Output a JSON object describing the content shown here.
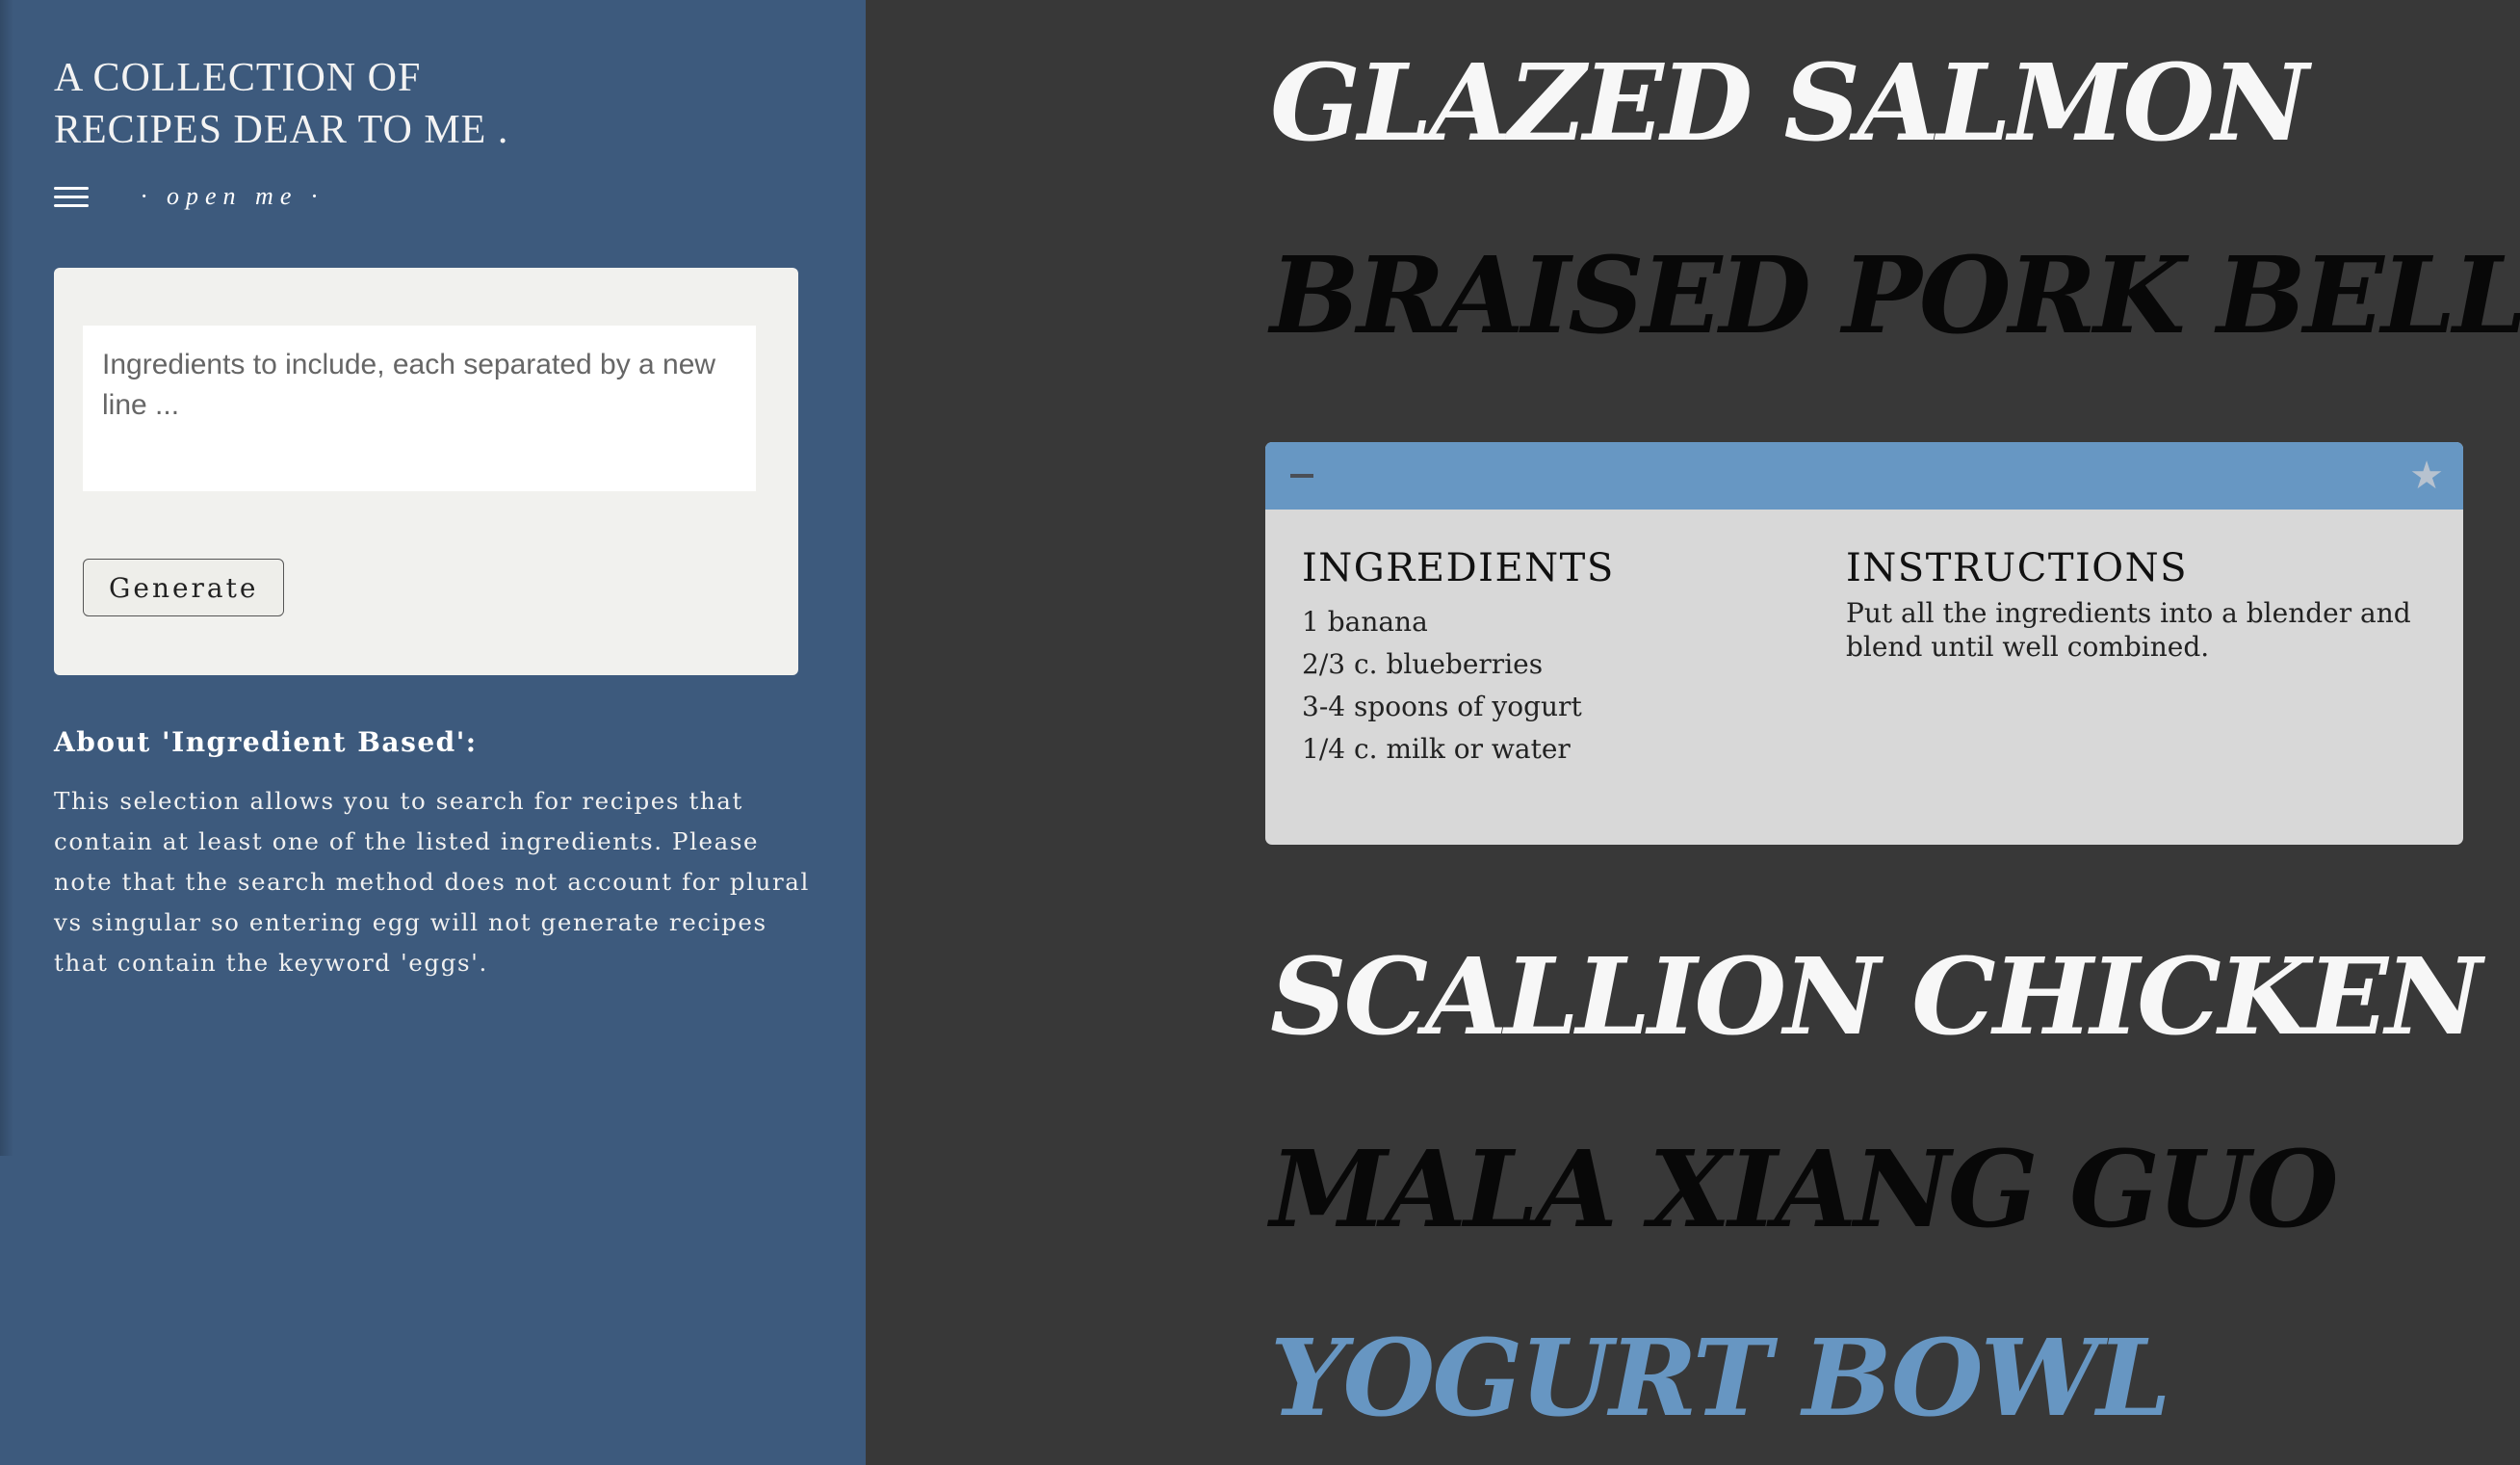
{
  "sidebar": {
    "title_line1": "A COLLECTION OF",
    "title_line2": "RECIPES DEAR TO ME .",
    "menu_label": "· open me ·",
    "search": {
      "placeholder": "Ingredients to include, each separated by a new line ...",
      "value": "",
      "button_label": "Generate"
    },
    "about": {
      "title": "About 'Ingredient Based':",
      "text": "This selection allows you to search for recipes that contain at least one of the listed ingredients. Please note that the search method does not account for plural vs singular so entering egg will not generate recipes that contain the keyword 'eggs'."
    }
  },
  "recipes": [
    {
      "title": "GLAZED SALMON"
    },
    {
      "title": "BRAISED PORK BELLY"
    },
    {
      "title": "SCALLION CHICKEN"
    },
    {
      "title": "MALA XIANG GUO"
    },
    {
      "title": "YOGURT BOWL"
    }
  ],
  "expanded_recipe": {
    "ingredients_heading": "INGREDIENTS",
    "instructions_heading": "INSTRUCTIONS",
    "ingredients": [
      "1 banana",
      "2/3 c. blueberries",
      "3-4 spoons of yogurt",
      "1/4 c. milk or water"
    ],
    "instructions": "Put all the ingredients into a blender and blend until well combined.",
    "collapse_icon": "minus-icon",
    "favorite_icon": "star-icon"
  },
  "colors": {
    "sidebar_bg": "#3d5a7d",
    "main_bg": "#383838",
    "accent_blue": "#6796c2",
    "card_bg": "#d8d8d8"
  }
}
